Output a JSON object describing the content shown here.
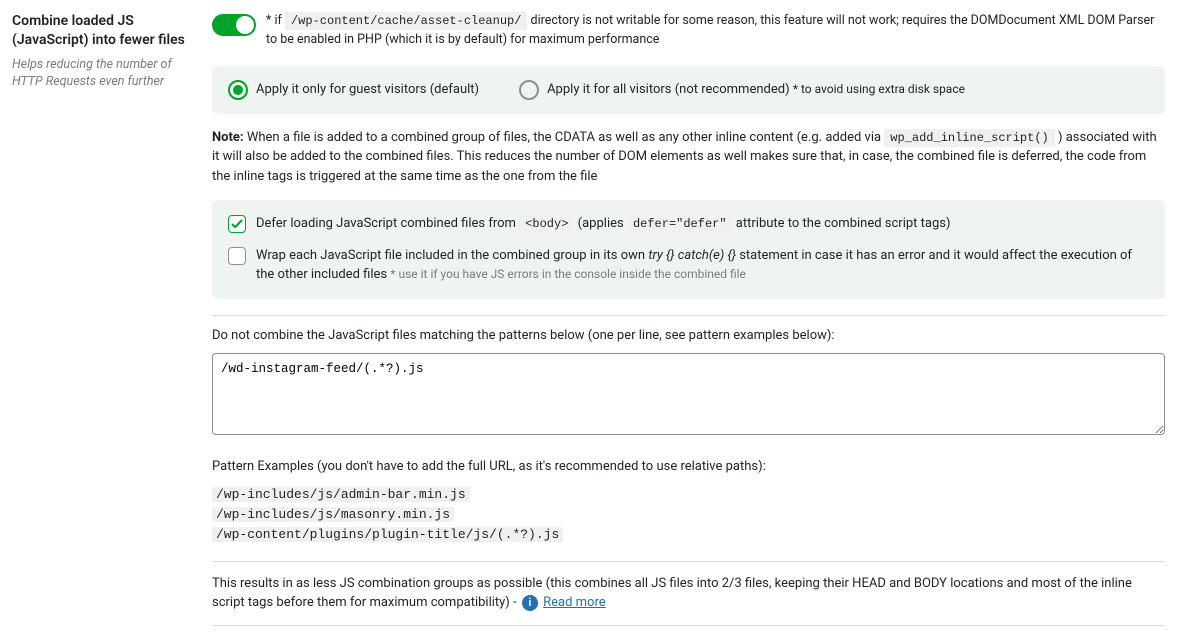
{
  "sidebar": {
    "title": "Combine loaded JS (JavaScript) into fewer files",
    "subtitle": "Helps reducing the number of HTTP Requests even further"
  },
  "toggle": {
    "note_prefix": "* if",
    "note_code": "/wp-content/cache/asset-cleanup/",
    "note_suffix": "directory is not writable for some reason, this feature will not work; requires the DOMDocument XML DOM Parser to be enabled in PHP (which it is by default) for maximum performance"
  },
  "radio": {
    "guest": "Apply it only for guest visitors (default)",
    "all": "Apply it for all visitors (not recommended)",
    "all_hint": "* to avoid using extra disk space"
  },
  "note": {
    "label": "Note:",
    "text_a": "When a file is added to a combined group of files, the CDATA as well as any other inline content (e.g. added via",
    "code": "wp_add_inline_script()",
    "text_b": ") associated with it will also be added to the combined files. This reduces the number of DOM elements as well makes sure that, in case, the combined file is deferred, the code from the inline tags is triggered at the same time as the one from the file"
  },
  "checks": {
    "defer_a": "Defer loading JavaScript combined files from",
    "defer_body": "<body>",
    "defer_b": "(applies",
    "defer_attr": "defer=\"defer\"",
    "defer_c": "attribute to the combined script tags)",
    "wrap_a": "Wrap each JavaScript file included in the combined group in its own",
    "wrap_code": "try {} catch(e) {}",
    "wrap_b": "statement in case it has an error and it would affect the execution of the other included files",
    "wrap_hint": "* use it if you have JS errors in the console inside the combined file"
  },
  "exclude": {
    "label": "Do not combine the JavaScript files matching the patterns below (one per line, see pattern examples below):",
    "value": "/wd-instagram-feed/(.*?).js"
  },
  "patterns": {
    "label": "Pattern Examples (you don't have to add the full URL, as it's recommended to use relative paths):",
    "ex1": "/wp-includes/js/admin-bar.min.js",
    "ex2": "/wp-includes/js/masonry.min.js",
    "ex3": "/wp-content/plugins/plugin-title/js/(.*?).js"
  },
  "result": {
    "text": "This results in as less JS combination groups as possible (this combines all JS files into 2/3 files, keeping their HEAD and BODY locations and most of the inline script tags before them for maximum compatibility) -",
    "link": "Read more"
  }
}
